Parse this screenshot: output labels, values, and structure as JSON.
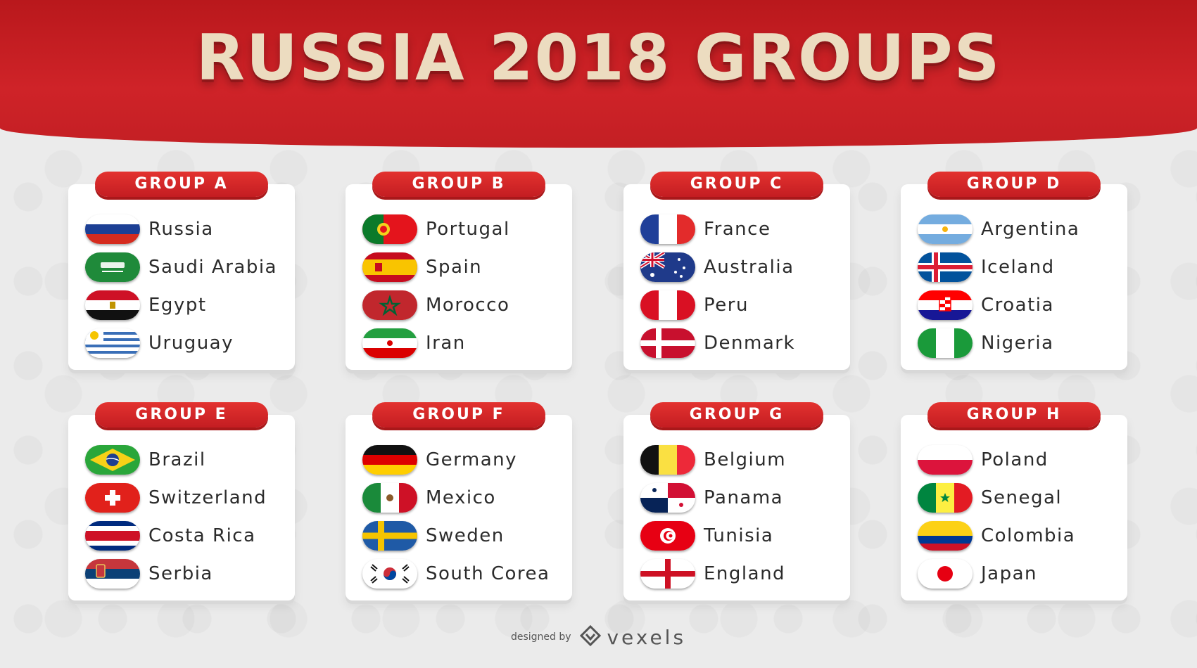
{
  "title": "RUSSIA 2018  GROUPS",
  "credit": {
    "prefix": "designed by",
    "brand": "vexels"
  },
  "groups": [
    {
      "label": "GROUP A",
      "teams": [
        {
          "name": "Russia",
          "flag": "russia"
        },
        {
          "name": "Saudi Arabia",
          "flag": "saudi"
        },
        {
          "name": "Egypt",
          "flag": "egypt"
        },
        {
          "name": "Uruguay",
          "flag": "uruguay"
        }
      ]
    },
    {
      "label": "GROUP B",
      "teams": [
        {
          "name": "Portugal",
          "flag": "portugal"
        },
        {
          "name": "Spain",
          "flag": "spain"
        },
        {
          "name": "Morocco",
          "flag": "morocco"
        },
        {
          "name": "Iran",
          "flag": "iran"
        }
      ]
    },
    {
      "label": "GROUP C",
      "teams": [
        {
          "name": "France",
          "flag": "france"
        },
        {
          "name": "Australia",
          "flag": "australia"
        },
        {
          "name": "Peru",
          "flag": "peru"
        },
        {
          "name": "Denmark",
          "flag": "denmark"
        }
      ]
    },
    {
      "label": "GROUP D",
      "teams": [
        {
          "name": "Argentina",
          "flag": "argentina"
        },
        {
          "name": "Iceland",
          "flag": "iceland"
        },
        {
          "name": "Croatia",
          "flag": "croatia"
        },
        {
          "name": "Nigeria",
          "flag": "nigeria"
        }
      ]
    },
    {
      "label": "GROUP E",
      "teams": [
        {
          "name": "Brazil",
          "flag": "brazil"
        },
        {
          "name": "Switzerland",
          "flag": "switzerland"
        },
        {
          "name": "Costa Rica",
          "flag": "costarica"
        },
        {
          "name": "Serbia",
          "flag": "serbia"
        }
      ]
    },
    {
      "label": "GROUP F",
      "teams": [
        {
          "name": "Germany",
          "flag": "germany"
        },
        {
          "name": "Mexico",
          "flag": "mexico"
        },
        {
          "name": "Sweden",
          "flag": "sweden"
        },
        {
          "name": "South Corea",
          "flag": "southkorea"
        }
      ]
    },
    {
      "label": "GROUP G",
      "teams": [
        {
          "name": "Belgium",
          "flag": "belgium"
        },
        {
          "name": "Panama",
          "flag": "panama"
        },
        {
          "name": "Tunisia",
          "flag": "tunisia"
        },
        {
          "name": "England",
          "flag": "england"
        }
      ]
    },
    {
      "label": "GROUP H",
      "teams": [
        {
          "name": "Poland",
          "flag": "poland"
        },
        {
          "name": "Senegal",
          "flag": "senegal"
        },
        {
          "name": "Colombia",
          "flag": "colombia"
        },
        {
          "name": "Japan",
          "flag": "japan"
        }
      ]
    }
  ]
}
